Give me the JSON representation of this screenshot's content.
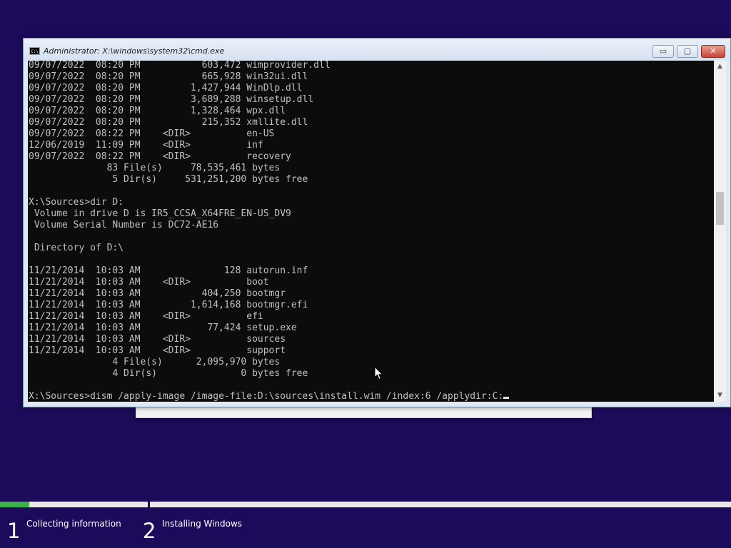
{
  "window": {
    "title": "Administrator: X:\\windows\\system32\\cmd.exe",
    "icon_label": "C:\\",
    "minimize_glyph": "▭",
    "maximize_glyph": "▢",
    "close_glyph": "✕"
  },
  "console": {
    "lines": [
      "09/07/2022  08:20 PM           603,472 wimprovider.dll",
      "09/07/2022  08:20 PM           665,928 win32ui.dll",
      "09/07/2022  08:20 PM         1,427,944 WinDlp.dll",
      "09/07/2022  08:20 PM         3,689,288 winsetup.dll",
      "09/07/2022  08:20 PM         1,328,464 wpx.dll",
      "09/07/2022  08:20 PM           215,352 xmllite.dll",
      "09/07/2022  08:22 PM    <DIR>          en-US",
      "12/06/2019  11:09 PM    <DIR>          inf",
      "09/07/2022  08:22 PM    <DIR>          recovery",
      "              83 File(s)     78,535,461 bytes",
      "               5 Dir(s)     531,251,200 bytes free",
      "",
      "X:\\Sources>dir D:",
      " Volume in drive D is IR5_CCSA_X64FRE_EN-US_DV9",
      " Volume Serial Number is DC72-AE16",
      "",
      " Directory of D:\\",
      "",
      "11/21/2014  10:03 AM               128 autorun.inf",
      "11/21/2014  10:03 AM    <DIR>          boot",
      "11/21/2014  10:03 AM           404,250 bootmgr",
      "11/21/2014  10:03 AM         1,614,168 bootmgr.efi",
      "11/21/2014  10:03 AM    <DIR>          efi",
      "11/21/2014  10:03 AM            77,424 setup.exe",
      "11/21/2014  10:03 AM    <DIR>          sources",
      "11/21/2014  10:03 AM    <DIR>          support",
      "               4 File(s)      2,095,970 bytes",
      "               4 Dir(s)               0 bytes free",
      ""
    ],
    "prompt_line": "X:\\Sources>dism /apply-image /image-file:D:\\sources\\install.wim /index:6 /applydir:C:"
  },
  "scrollbar": {
    "up_glyph": "▲",
    "down_glyph": "▼"
  },
  "setup_steps": [
    {
      "number": "1",
      "label": "Collecting information"
    },
    {
      "number": "2",
      "label": "Installing Windows"
    }
  ],
  "progress": {
    "step1_fraction": 0.2
  },
  "colors": {
    "background": "#1c0a5a",
    "progress_fill": "#3cb04a",
    "console_text": "#c0c0c0",
    "console_bg": "#0c0c0c"
  }
}
